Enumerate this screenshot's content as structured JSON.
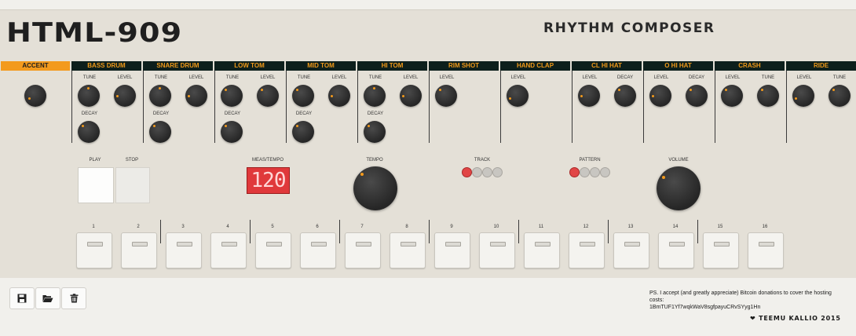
{
  "app": {
    "title": "HTML-909",
    "subtitle": "RHYTHM COMPOSER"
  },
  "instruments": [
    {
      "id": "accent",
      "name": "ACCENT",
      "knobs": [
        {
          "label": ""
        }
      ]
    },
    {
      "id": "bass-drum",
      "name": "BASS DRUM",
      "knobs": [
        {
          "label": "TUNE"
        },
        {
          "label": "LEVEL"
        },
        {
          "label": "DECAY"
        }
      ]
    },
    {
      "id": "snare-drum",
      "name": "SNARE DRUM",
      "knobs": [
        {
          "label": "TUNE"
        },
        {
          "label": "LEVEL"
        },
        {
          "label": "DECAY"
        }
      ]
    },
    {
      "id": "low-tom",
      "name": "LOW TOM",
      "knobs": [
        {
          "label": "TUNE"
        },
        {
          "label": "LEVEL"
        },
        {
          "label": "DECAY"
        }
      ]
    },
    {
      "id": "mid-tom",
      "name": "MID TOM",
      "knobs": [
        {
          "label": "TUNE"
        },
        {
          "label": "LEVEL"
        },
        {
          "label": "DECAY"
        }
      ]
    },
    {
      "id": "hi-tom",
      "name": "HI TOM",
      "knobs": [
        {
          "label": "TUNE"
        },
        {
          "label": "LEVEL"
        },
        {
          "label": "DECAY"
        }
      ]
    },
    {
      "id": "rim-shot",
      "name": "RIM SHOT",
      "knobs": [
        {
          "label": "LEVEL"
        }
      ]
    },
    {
      "id": "hand-clap",
      "name": "HAND CLAP",
      "knobs": [
        {
          "label": "LEVEL"
        }
      ]
    },
    {
      "id": "cl-hi-hat",
      "name": "CL HI HAT",
      "knobs": [
        {
          "label": "LEVEL"
        },
        {
          "label": "DECAY"
        }
      ]
    },
    {
      "id": "o-hi-hat",
      "name": "O HI HAT",
      "knobs": [
        {
          "label": "LEVEL"
        },
        {
          "label": "DECAY"
        }
      ]
    },
    {
      "id": "crash",
      "name": "CRASH",
      "knobs": [
        {
          "label": "LEVEL"
        },
        {
          "label": "TUNE"
        }
      ]
    },
    {
      "id": "ride",
      "name": "RIDE",
      "knobs": [
        {
          "label": "LEVEL"
        },
        {
          "label": "TUNE"
        }
      ]
    }
  ],
  "controls": {
    "play_label": "PLAY",
    "stop_label": "STOP",
    "meas_tempo_label": "MEAS/TEMPO",
    "display_value": "120",
    "tempo_label": "TEMPO",
    "track_label": "TRACK",
    "pattern_label": "PATTERN",
    "volume_label": "VOLUME",
    "track_leds": [
      true,
      false,
      false,
      false
    ],
    "pattern_leds": [
      true,
      false,
      false,
      false
    ]
  },
  "steps": [
    "1",
    "2",
    "3",
    "4",
    "5",
    "6",
    "7",
    "8",
    "9",
    "10",
    "11",
    "12",
    "13",
    "14",
    "15",
    "16"
  ],
  "toolbar": [
    {
      "id": "save",
      "icon": "floppy-disk-icon"
    },
    {
      "id": "open",
      "icon": "folder-open-icon"
    },
    {
      "id": "delete",
      "icon": "trash-icon"
    }
  ],
  "footer": {
    "donation_text": "PS. I accept (and greatly appreciate) Bitcoin donations to cover the hosting costs:",
    "bitcoin_address": "1BmTUF1Yf7wqkWaV8sgfpayuCRvSYyg1Hn",
    "credit": "TEEMU KALLIO 2015"
  },
  "colors": {
    "accent_orange": "#f39a1d",
    "header_dark": "#0d1f1c",
    "led_red": "#e14646",
    "display_red": "#e0393b"
  }
}
